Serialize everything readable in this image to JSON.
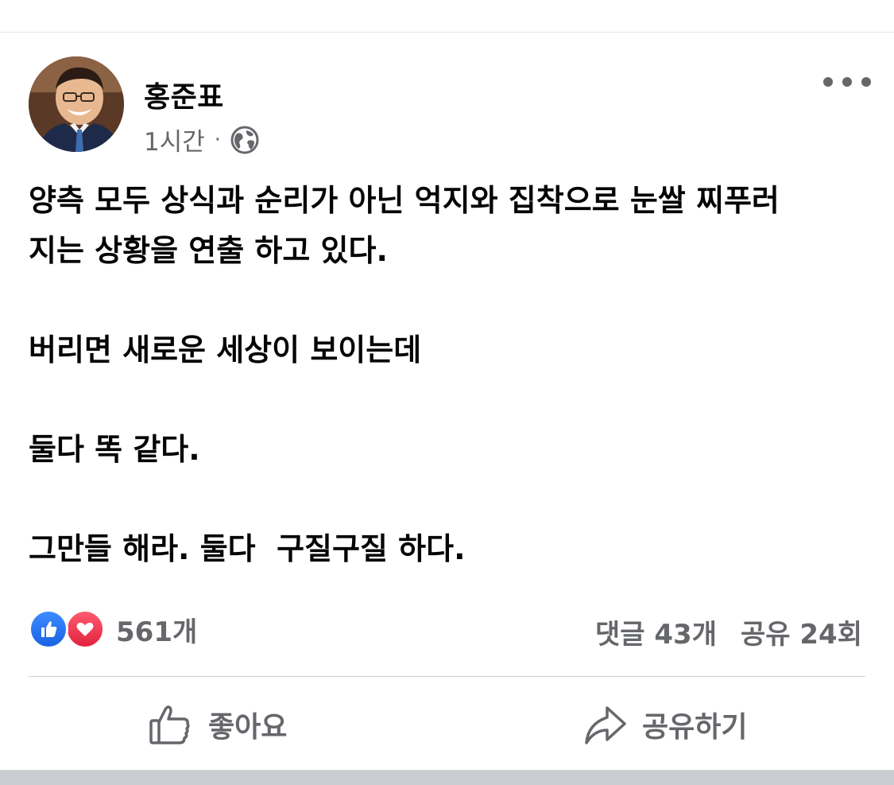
{
  "post": {
    "author": "홍준표",
    "timestamp": "1시간",
    "meta_separator": "·",
    "privacy_icon": "globe-icon",
    "body": {
      "p1_line1": "양측 모두 상식과 순리가 아닌 억지와 집착으로 눈쌀 찌푸러",
      "p1_line2": "지는 상황을 연출 하고 있다.",
      "p2": "버리면 새로운 세상이 보이는데",
      "p3": "둘다 똑 같다.",
      "p4": "그만들 해라. 둘다  구질구질 하다."
    }
  },
  "reactions": {
    "icons": [
      "like-icon",
      "love-icon"
    ],
    "count": "561개"
  },
  "stats": {
    "comments": "댓글 43개",
    "shares": "공유 24회"
  },
  "actions": {
    "like_label": "좋아요",
    "share_label": "공유하기"
  },
  "colors": {
    "text_primary": "#050505",
    "text_secondary": "#65676b",
    "like_blue": "#1a63e4",
    "love_red": "#e1233f",
    "divider": "#ced0d4"
  }
}
